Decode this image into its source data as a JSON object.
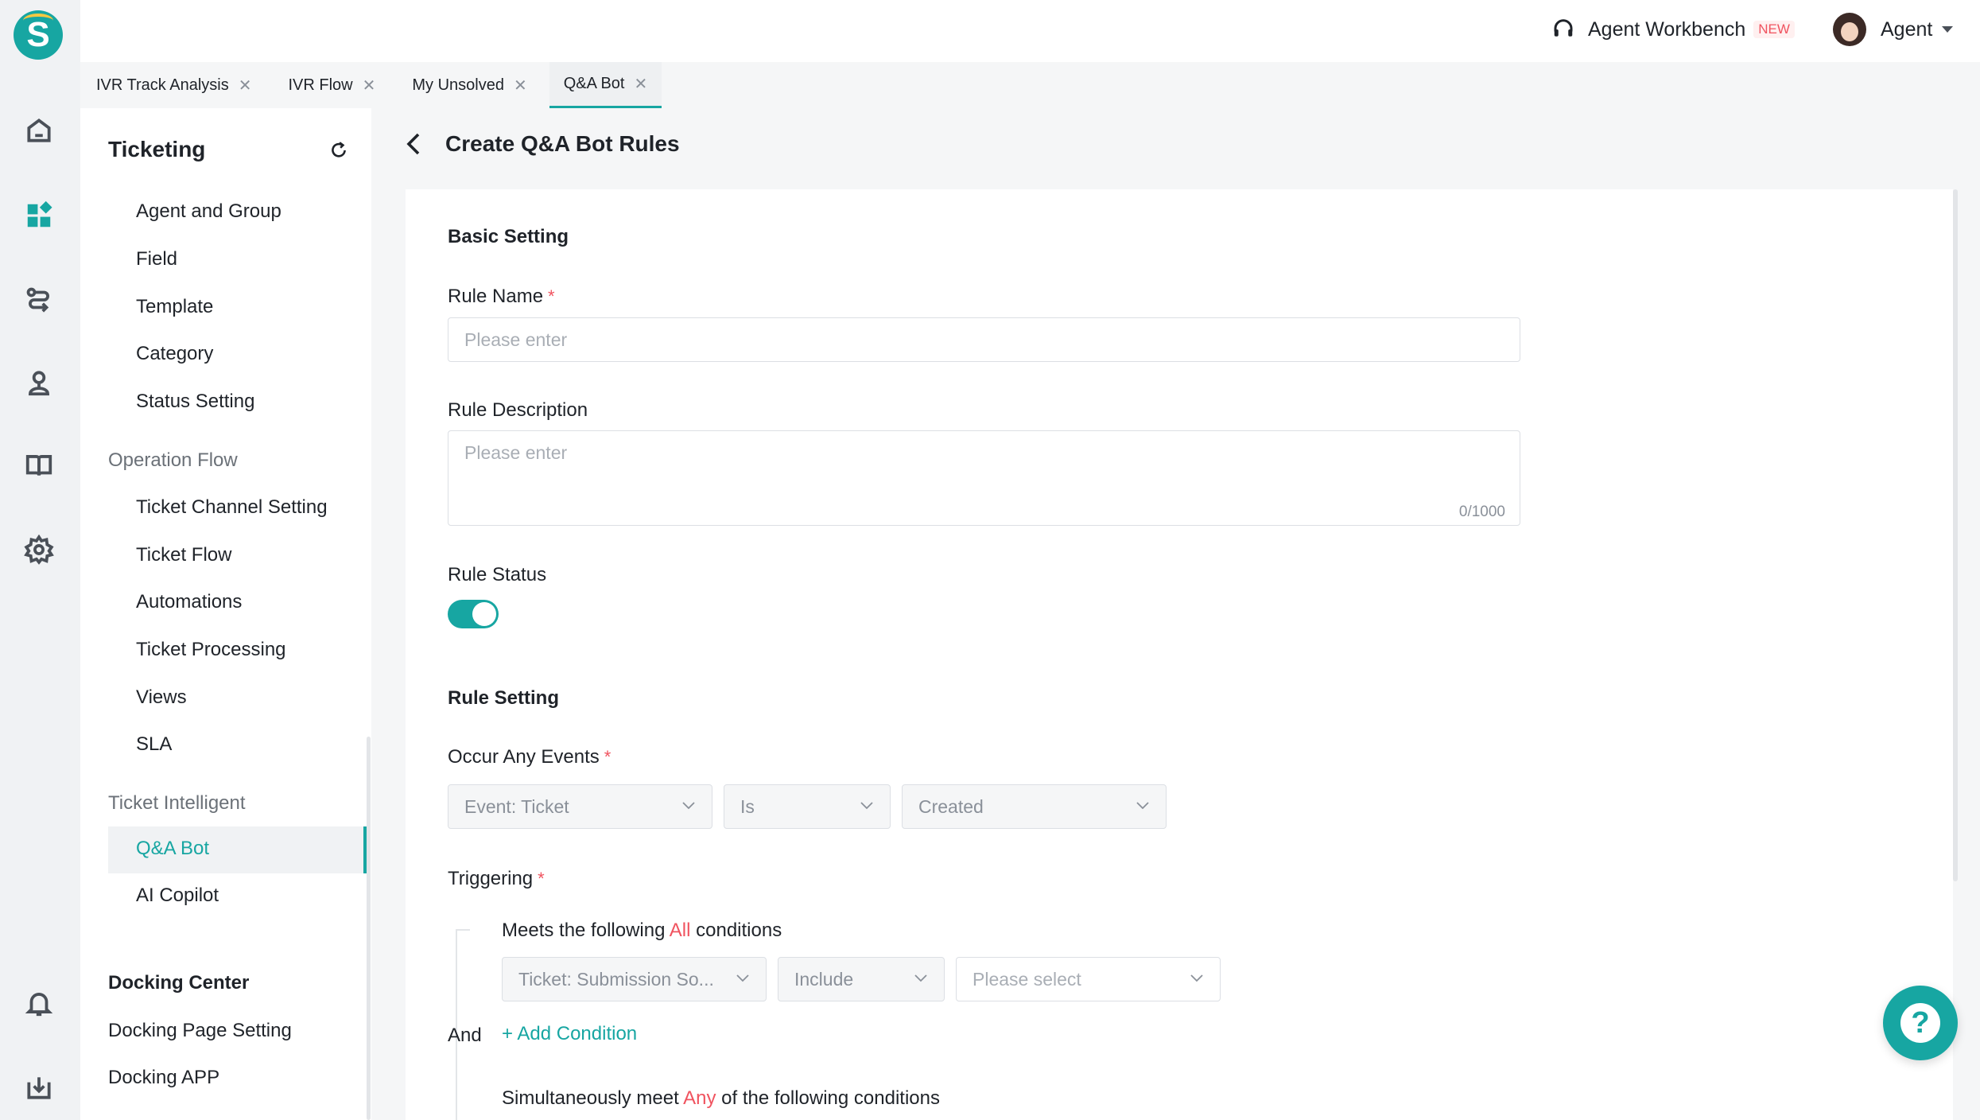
{
  "topbar": {
    "workbench_label": "Agent Workbench",
    "new_badge": "NEW",
    "agent_label": "Agent"
  },
  "tabs": [
    {
      "label": "IVR Track Analysis",
      "close": "✕"
    },
    {
      "label": "IVR Flow",
      "close": "✕"
    },
    {
      "label": "My Unsolved",
      "close": "✕"
    },
    {
      "label": "Q&A Bot",
      "close": "✕"
    }
  ],
  "sidebar": {
    "title": "Ticketing",
    "items_top": [
      "Agent and Group",
      "Field",
      "Template",
      "Category",
      "Status Setting"
    ],
    "group_operation": "Operation Flow",
    "items_operation": [
      "Ticket Channel Setting",
      "Ticket Flow",
      "Automations",
      "Ticket Processing",
      "Views",
      "SLA"
    ],
    "group_intelligent": "Ticket Intelligent",
    "items_intelligent": [
      "Q&A Bot",
      "AI Copilot"
    ],
    "docking_head": "Docking Center",
    "items_docking": [
      "Docking Page Setting",
      "Docking APP"
    ]
  },
  "page": {
    "title": "Create Q&A Bot Rules"
  },
  "form": {
    "basic_setting": "Basic Setting",
    "rule_name_label": "Rule Name",
    "required_mark": "*",
    "rule_name_placeholder": "Please enter",
    "rule_desc_label": "Rule Description",
    "rule_desc_placeholder": "Please enter",
    "rule_desc_counter": "0/1000",
    "rule_status_label": "Rule Status",
    "rule_status_on": true,
    "rule_setting": "Rule Setting",
    "occur_events_label": "Occur Any Events",
    "event_select": "Event: Ticket",
    "is_select": "Is",
    "created_select": "Created",
    "triggering_label": "Triggering",
    "meets_prefix": "Meets the following ",
    "meets_all": "All",
    "meets_suffix": " conditions",
    "cond_field_select": "Ticket: Submission So...",
    "cond_op_select": "Include",
    "cond_value_placeholder": "Please select",
    "and_label": "And",
    "add_condition": "+ Add Condition",
    "simul_prefix": "Simultaneously meet ",
    "simul_any": "Any",
    "simul_suffix": " of the following conditions"
  },
  "colors": {
    "accent": "#17a6a2",
    "required": "#f0535f"
  },
  "help_button": "?"
}
